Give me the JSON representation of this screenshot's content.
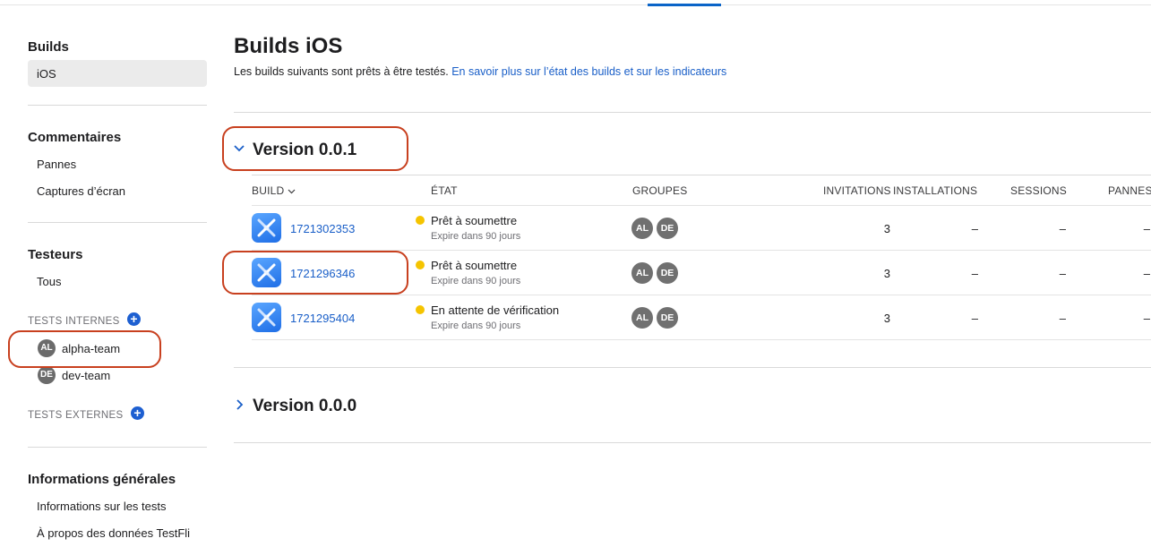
{
  "sidebar": {
    "builds": {
      "heading": "Builds",
      "items": [
        "iOS"
      ]
    },
    "feedback": {
      "heading": "Commentaires",
      "items": [
        "Pannes",
        "Captures d’écran"
      ]
    },
    "testers": {
      "heading": "Testeurs",
      "all": "Tous",
      "internal_caption": "TESTS INTERNES",
      "groups": [
        {
          "initials": "AL",
          "name": "alpha-team"
        },
        {
          "initials": "DE",
          "name": "dev-team"
        }
      ],
      "external_caption": "TESTS EXTERNES"
    },
    "general": {
      "heading": "Informations générales",
      "items": [
        "Informations sur les tests",
        "À propos des données TestFli"
      ]
    }
  },
  "main": {
    "title": "Builds iOS",
    "subtitle": "Les builds suivants sont prêts à être testés.",
    "subtitle_link": "En savoir plus sur l’état des builds et sur les indicateurs",
    "columns": {
      "build": "BUILD",
      "state": "ÉTAT",
      "groups": "GROUPES",
      "invitations": "INVITATIONS",
      "installations": "INSTALLATIONS",
      "sessions": "SESSIONS",
      "crashes": "PANNES"
    },
    "versions": [
      {
        "label": "Version 0.0.1",
        "expanded": true,
        "builds": [
          {
            "number": "1721302353",
            "status": "Prêt à soumettre",
            "expires": "Expire dans 90 jours",
            "groups": [
              "AL",
              "DE"
            ],
            "invitations": "3",
            "installations": "–",
            "sessions": "–",
            "crashes": "–"
          },
          {
            "number": "1721296346",
            "status": "Prêt à soumettre",
            "expires": "Expire dans 90 jours",
            "groups": [
              "AL",
              "DE"
            ],
            "invitations": "3",
            "installations": "–",
            "sessions": "–",
            "crashes": "–"
          },
          {
            "number": "1721295404",
            "status": "En attente de vérification",
            "expires": "Expire dans 90 jours",
            "groups": [
              "AL",
              "DE"
            ],
            "invitations": "3",
            "installations": "–",
            "sessions": "–",
            "crashes": "–"
          }
        ]
      },
      {
        "label": "Version 0.0.0",
        "expanded": false
      }
    ]
  },
  "colors": {
    "accent": "#1a5fc8",
    "highlight": "#c8401f",
    "status_dot": "#f5c400"
  }
}
